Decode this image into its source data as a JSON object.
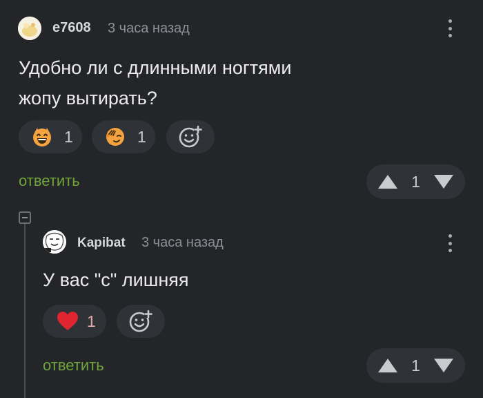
{
  "comment": {
    "username": "e7608",
    "time": "3 часа назад",
    "text_line1": "Удобно ли с длинными ногтями",
    "text_line2": "жопу вытирать?",
    "reactions": [
      {
        "icon": "grinning-face-icon",
        "count": "1"
      },
      {
        "icon": "facepalm-face-icon",
        "count": "1"
      }
    ],
    "reply_label": "ответить",
    "rating": "1"
  },
  "reply": {
    "username": "Kapibat",
    "time": "3 часа назад",
    "text": "У вас \"с\" лишняя",
    "reactions": [
      {
        "icon": "heart-icon",
        "count": "1",
        "color": "#e02530"
      }
    ],
    "reply_label": "ответить",
    "rating": "1"
  },
  "colors": {
    "background": "#232528",
    "pill": "#2f3236",
    "reply_link": "#6fa53a",
    "reaction_orange": "#f5a341"
  }
}
